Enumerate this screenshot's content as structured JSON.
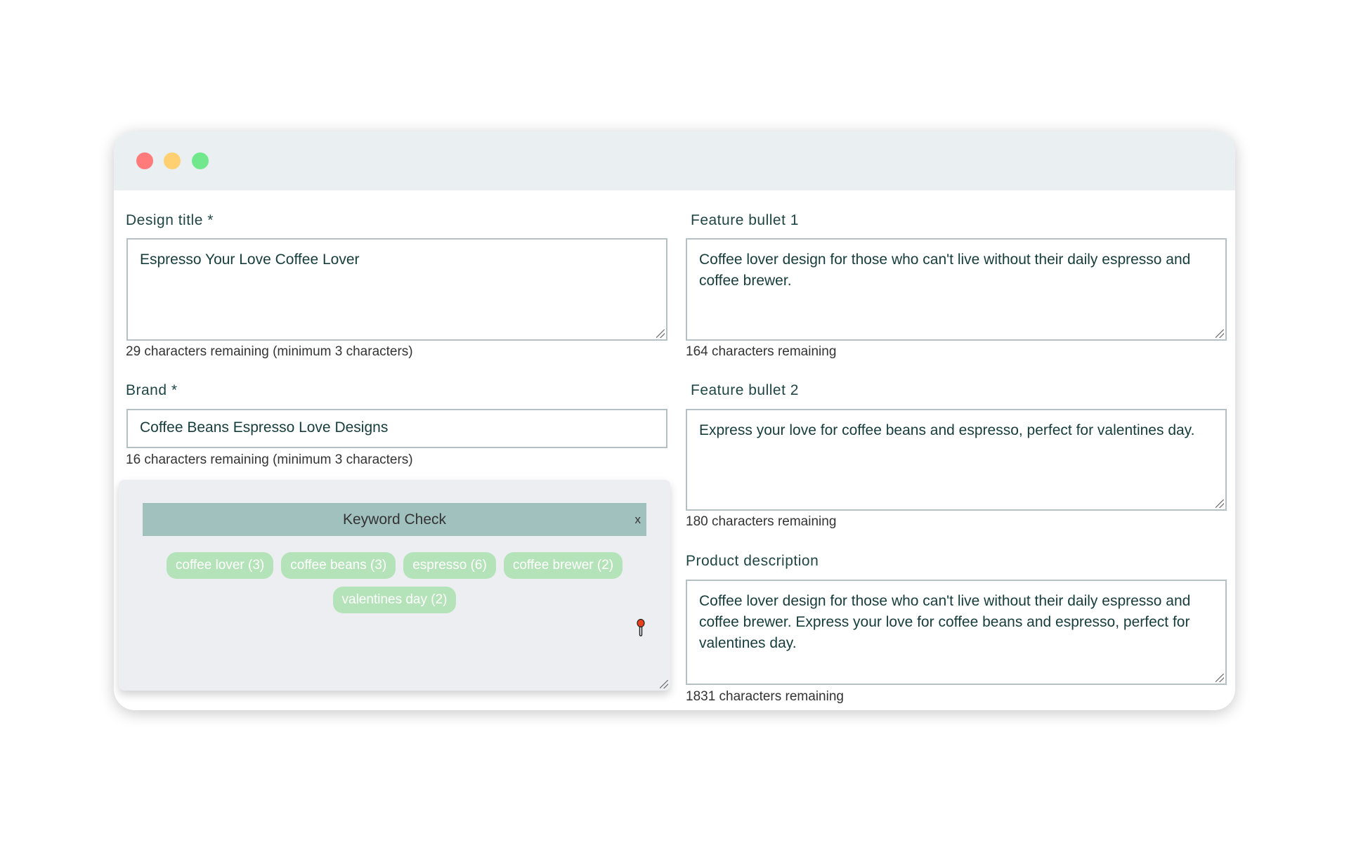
{
  "window": {
    "controls": [
      "close",
      "minimize",
      "maximize"
    ],
    "colors": {
      "close": "#ff7b7b",
      "minimize": "#ffd071",
      "maximize": "#72e88d"
    }
  },
  "left": {
    "design_title": {
      "label": "Design title *",
      "value": "Espresso Your Love Coffee Lover",
      "help": "29 characters remaining (minimum 3 characters)"
    },
    "brand": {
      "label": "Brand *",
      "value": "Coffee Beans Espresso Love Designs",
      "help": "16 characters remaining (minimum 3 characters)"
    },
    "keyword_check": {
      "title": "Keyword Check",
      "close_label": "x",
      "chips": [
        "coffee lover (3)",
        "coffee beans (3)",
        "espresso (6)",
        "coffee brewer (2)",
        "valentines day (2)"
      ],
      "pin_icon": "pushpin-icon"
    }
  },
  "right": {
    "feature_bullet_1": {
      "label": "Feature bullet 1",
      "value": "Coffee lover design for those who can't live without their daily espresso and coffee brewer.",
      "help": "164 characters remaining"
    },
    "feature_bullet_2": {
      "label": "Feature bullet 2",
      "value": "Express your love for coffee beans and espresso, perfect for valentines day.",
      "help": "180 characters remaining"
    },
    "product_description": {
      "label": "Product description",
      "value": "Coffee lover design for those who can't live without their daily espresso and coffee brewer. Express your love for coffee beans and espresso, perfect for valentines day.",
      "help": "1831 characters remaining"
    }
  }
}
